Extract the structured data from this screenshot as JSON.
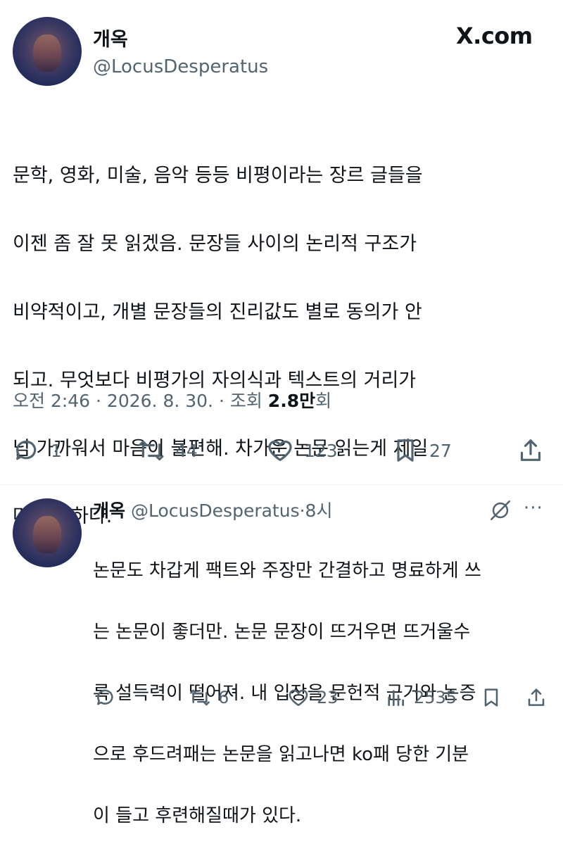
{
  "tweet": {
    "display_name": "개옥",
    "handle": "@LocusDesperatus",
    "site_logo": "X.com",
    "lines": [
      "문학, 영화, 미술, 음악 등등 비평이라는 장르 글들을",
      "이젠 좀 잘 못 읽겠음. 문장들 사이의 논리적 구조가",
      "비약적이고, 개별 문장들의 진리값도 별로 동의가 안",
      "되고. 무엇보다 비평가의 자의식과 텍스트의 거리가",
      "넘 가까워서 마음이 불편해. 차가운 논문 읽는게 제일",
      "마음 편하다."
    ],
    "meta_prefix": "오전 2:46 · 2026. 8. 30. · 조회 ",
    "views": "2.8만",
    "views_suffix": "회",
    "actions": {
      "reply_count": "1",
      "retweet_count": "44",
      "like_count": "123",
      "bookmark_count": "27",
      "reply_icon": "reply-icon",
      "retweet_icon": "retweet-icon",
      "like_icon": "heart-icon",
      "bookmark_icon": "bookmark-icon",
      "share_icon": "share-icon"
    }
  },
  "reply": {
    "display_name": "개옥",
    "handle": "@LocusDesperatus",
    "separator": "·",
    "time": "8시",
    "lines": [
      "논문도 차갑게 팩트와 주장만 간결하고 명료하게 쓰",
      "는 논문이 좋더만. 논문 문장이 뜨거우면 뜨거울수",
      "록 설득력이 떨어져. 내 입장을 문헌적 근거와 논증",
      "으로 후드려패는 논문을 읽고나면 ko패 당한 기분",
      "이 들고 후련해질때가 있다."
    ],
    "actions": {
      "reply_count": "",
      "retweet_count": "6",
      "like_count": "23",
      "views_count": "2535"
    },
    "more": "···"
  },
  "colors": {
    "text": "#0f1419",
    "secondary": "#536471",
    "divider": "#eff3f4"
  }
}
